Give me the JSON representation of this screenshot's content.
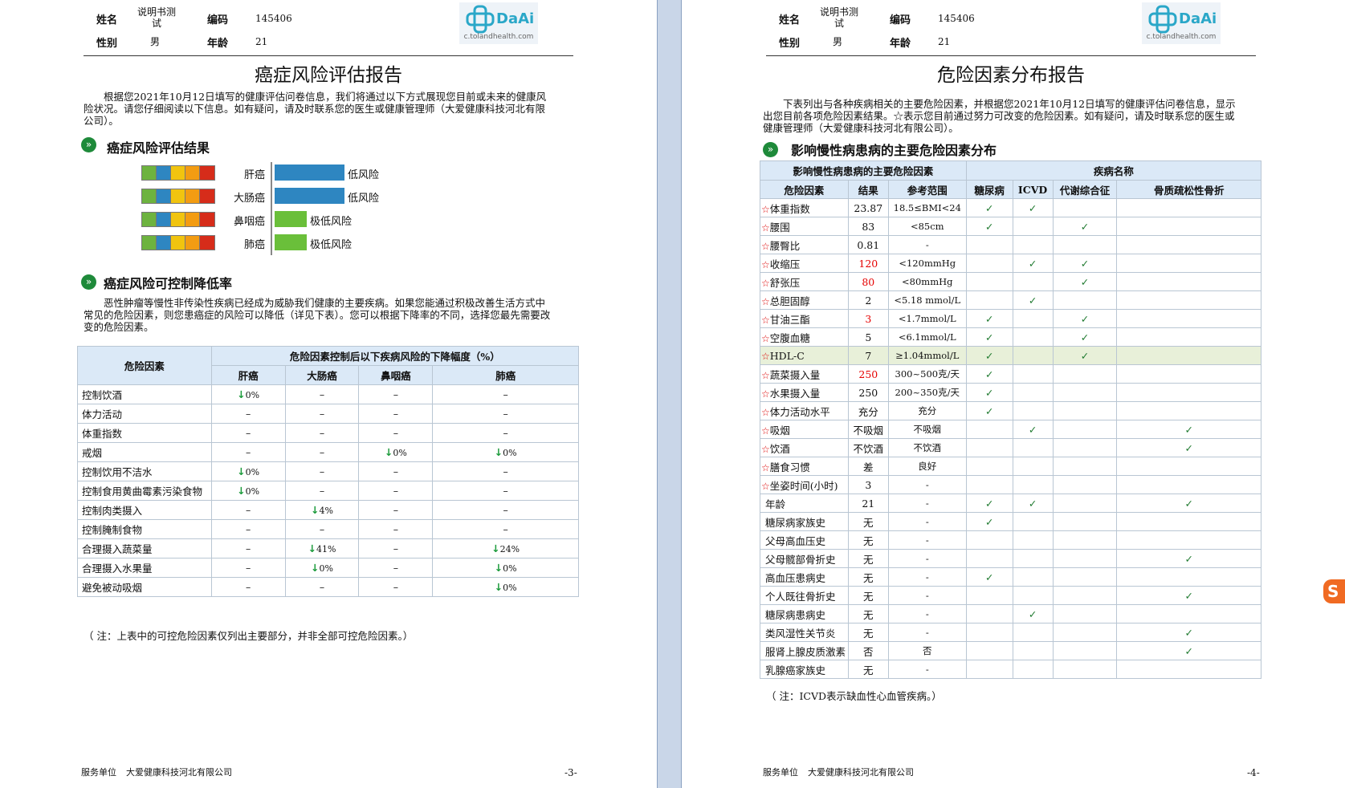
{
  "header": {
    "name_label": "姓名",
    "name_value": "说明书测试",
    "id_label": "编码",
    "id_value": "145406",
    "gender_label": "性别",
    "gender_value": "男",
    "age_label": "年龄",
    "age_value": "21",
    "logo_text": "DaAi",
    "logo_url": "c.tolandhealth.com"
  },
  "page3": {
    "title": "癌症风险评估报告",
    "intro": "根据您2021年10月12日填写的健康评估问卷信息，我们将通过以下方式展现您目前或未来的健康风险状况。请您仔细阅读以下信息。如有疑问，请及时联系您的医生或健康管理师（大爱健康科技河北有限公司）。",
    "section1": "癌症风险评估结果",
    "cancers": [
      {
        "name": "肝癌",
        "risk": "低风险",
        "level": 0.48
      },
      {
        "name": "大肠癌",
        "risk": "低风险",
        "level": 0.48
      },
      {
        "name": "鼻咽癌",
        "risk": "极低风险",
        "level": 0.22
      },
      {
        "name": "肺癌",
        "risk": "极低风险",
        "level": 0.22
      }
    ],
    "section2": "癌症风险可控制降低率",
    "para2": "恶性肿瘤等慢性非传染性疾病已经成为威胁我们健康的主要疾病。如果您能通过积极改善生活方式中常见的危险因素，则您患癌症的风险可以降低（详见下表）。您可以根据下降率的不同，选择您最先需要改变的危险因素。",
    "table": {
      "col_factor": "危险因素",
      "col_group": "危险因素控制后以下疾病风险的下降幅度（%）",
      "diseases": [
        "肝癌",
        "大肠癌",
        "鼻咽癌",
        "肺癌"
      ],
      "rows": [
        {
          "factor": "控制饮酒",
          "vals": [
            "0%",
            "–",
            "–",
            "–"
          ]
        },
        {
          "factor": "体力活动",
          "vals": [
            "–",
            "–",
            "–",
            "–"
          ]
        },
        {
          "factor": "体重指数",
          "vals": [
            "–",
            "–",
            "–",
            "–"
          ]
        },
        {
          "factor": "戒烟",
          "vals": [
            "–",
            "–",
            "0%",
            "0%"
          ]
        },
        {
          "factor": "控制饮用不洁水",
          "vals": [
            "0%",
            "–",
            "–",
            "–"
          ]
        },
        {
          "factor": "控制食用黄曲霉素污染食物",
          "vals": [
            "0%",
            "–",
            "–",
            "–"
          ]
        },
        {
          "factor": "控制肉类摄入",
          "vals": [
            "–",
            "4%",
            "–",
            "–"
          ]
        },
        {
          "factor": "控制腌制食物",
          "vals": [
            "–",
            "–",
            "–",
            "–"
          ]
        },
        {
          "factor": "合理摄入蔬菜量",
          "vals": [
            "–",
            "41%",
            "–",
            "24%"
          ]
        },
        {
          "factor": "合理摄入水果量",
          "vals": [
            "–",
            "0%",
            "–",
            "0%"
          ]
        },
        {
          "factor": "避免被动吸烟",
          "vals": [
            "–",
            "–",
            "–",
            "0%"
          ]
        }
      ]
    },
    "note": "（ 注：上表中的可控危险因素仅列出主要部分，并非全部可控危险因素。）",
    "footer_label": "服务单位",
    "footer_company": "大爱健康科技河北有限公司",
    "page_num": "-3-"
  },
  "page4": {
    "title": "危险因素分布报告",
    "intro": "下表列出与各种疾病相关的主要危险因素，并根据您2021年10月12日填写的健康评估问卷信息，显示出您目前各项危险因素结果。☆表示您目前通过努力可改变的危险因素。如有疑问，请及时联系您的医生或健康管理师（大爱健康科技河北有限公司）。",
    "section": "影响慢性病患病的主要危险因素分布",
    "table": {
      "group1": "影响慢性病患病的主要危险因素",
      "group2": "疾病名称",
      "cols": [
        "危险因素",
        "结果",
        "参考范围",
        "糖尿病",
        "ICVD",
        "代谢综合征",
        "骨质疏松性骨折"
      ],
      "rows": [
        {
          "star": true,
          "factor": "体重指数",
          "result": "23.87",
          "red": false,
          "ref": "18.5≤BMI<24",
          "marks": [
            1,
            1,
            0,
            0
          ]
        },
        {
          "star": true,
          "factor": "腰围",
          "result": "83",
          "red": false,
          "ref": "<85cm",
          "marks": [
            1,
            0,
            1,
            0
          ]
        },
        {
          "star": true,
          "factor": "腰臀比",
          "result": "0.81",
          "red": false,
          "ref": "-",
          "marks": [
            0,
            0,
            0,
            0
          ]
        },
        {
          "star": true,
          "factor": "收缩压",
          "result": "120",
          "red": true,
          "ref": "<120mmHg",
          "marks": [
            0,
            1,
            1,
            0
          ]
        },
        {
          "star": true,
          "factor": "舒张压",
          "result": "80",
          "red": true,
          "ref": "<80mmHg",
          "marks": [
            0,
            0,
            1,
            0
          ]
        },
        {
          "star": true,
          "factor": "总胆固醇",
          "result": "2",
          "red": false,
          "ref": "<5.18 mmol/L",
          "marks": [
            0,
            1,
            0,
            0
          ]
        },
        {
          "star": true,
          "factor": "甘油三酯",
          "result": "3",
          "red": true,
          "ref": "<1.7mmol/L",
          "marks": [
            1,
            0,
            1,
            0
          ]
        },
        {
          "star": true,
          "factor": "空腹血糖",
          "result": "5",
          "red": false,
          "ref": "<6.1mmol/L",
          "marks": [
            1,
            0,
            1,
            0
          ]
        },
        {
          "star": true,
          "factor": "HDL-C",
          "result": "7",
          "red": false,
          "ref": "≥1.04mmol/L",
          "marks": [
            1,
            0,
            1,
            0
          ],
          "hl": true
        },
        {
          "star": true,
          "factor": "蔬菜摄入量",
          "result": "250",
          "red": true,
          "ref": "300~500克/天",
          "marks": [
            1,
            0,
            0,
            0
          ]
        },
        {
          "star": true,
          "factor": "水果摄入量",
          "result": "250",
          "red": false,
          "ref": "200~350克/天",
          "marks": [
            1,
            0,
            0,
            0
          ]
        },
        {
          "star": true,
          "factor": "体力活动水平",
          "result": "充分",
          "red": false,
          "ref": "充分",
          "marks": [
            1,
            0,
            0,
            0
          ]
        },
        {
          "star": true,
          "factor": "吸烟",
          "result": "不吸烟",
          "red": false,
          "ref": "不吸烟",
          "marks": [
            0,
            1,
            0,
            1
          ]
        },
        {
          "star": true,
          "factor": "饮酒",
          "result": "不饮酒",
          "red": false,
          "ref": "不饮酒",
          "marks": [
            0,
            0,
            0,
            1
          ]
        },
        {
          "star": true,
          "factor": "膳食习惯",
          "result": "差",
          "red": false,
          "ref": "良好",
          "marks": [
            0,
            0,
            0,
            0
          ]
        },
        {
          "star": true,
          "factor": "坐姿时间(小时)",
          "result": "3",
          "red": false,
          "ref": "-",
          "marks": [
            0,
            0,
            0,
            0
          ]
        },
        {
          "star": false,
          "factor": "年龄",
          "result": "21",
          "red": false,
          "ref": "-",
          "marks": [
            1,
            1,
            0,
            1
          ]
        },
        {
          "star": false,
          "factor": "糖尿病家族史",
          "result": "无",
          "red": false,
          "ref": "-",
          "marks": [
            1,
            0,
            0,
            0
          ]
        },
        {
          "star": false,
          "factor": "父母高血压史",
          "result": "无",
          "red": false,
          "ref": "-",
          "marks": [
            0,
            0,
            0,
            0
          ]
        },
        {
          "star": false,
          "factor": "父母髋部骨折史",
          "result": "无",
          "red": false,
          "ref": "-",
          "marks": [
            0,
            0,
            0,
            1
          ]
        },
        {
          "star": false,
          "factor": "高血压患病史",
          "result": "无",
          "red": false,
          "ref": "-",
          "marks": [
            1,
            0,
            0,
            0
          ]
        },
        {
          "star": false,
          "factor": "个人既往骨折史",
          "result": "无",
          "red": false,
          "ref": "-",
          "marks": [
            0,
            0,
            0,
            1
          ]
        },
        {
          "star": false,
          "factor": "糖尿病患病史",
          "result": "无",
          "red": false,
          "ref": "-",
          "marks": [
            0,
            1,
            0,
            0
          ]
        },
        {
          "star": false,
          "factor": "类风湿性关节炎",
          "result": "无",
          "red": false,
          "ref": "-",
          "marks": [
            0,
            0,
            0,
            1
          ]
        },
        {
          "star": false,
          "factor": "服肾上腺皮质激素",
          "result": "否",
          "red": false,
          "ref": "否",
          "marks": [
            0,
            0,
            0,
            1
          ]
        },
        {
          "star": false,
          "factor": "乳腺癌家族史",
          "result": "无",
          "red": false,
          "ref": "-",
          "marks": [
            0,
            0,
            0,
            0
          ]
        }
      ]
    },
    "note": "（ 注：ICVD表示缺血性心血管疾病。）",
    "footer_label": "服务单位",
    "footer_company": "大爱健康科技河北有限公司",
    "page_num": "-4-"
  },
  "colors": {
    "meter": [
      "#6db33f",
      "#2e86c1",
      "#f1c40f",
      "#f39c12",
      "#d62c1a"
    ],
    "risk_low": "#2e86c1",
    "risk_very_low": "#6abf3a"
  }
}
